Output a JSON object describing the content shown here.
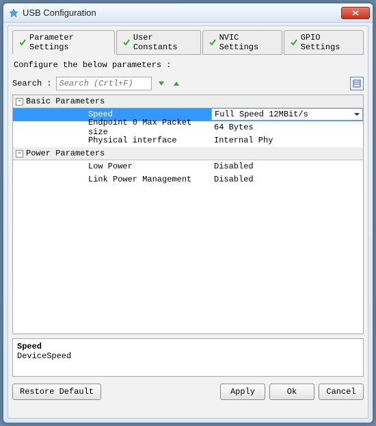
{
  "window": {
    "title": "USB Configuration"
  },
  "tabs": [
    {
      "label": "Parameter Settings"
    },
    {
      "label": "User Constants"
    },
    {
      "label": "NVIC Settings"
    },
    {
      "label": "GPIO Settings"
    }
  ],
  "instruction": "Configure the below parameters :",
  "search": {
    "label": "Search :",
    "placeholder": "Search (Crtl+F)"
  },
  "groups": [
    {
      "name": "Basic Parameters",
      "rows": [
        {
          "label": "Speed",
          "value": "Full Speed 12MBit/s",
          "selected": true,
          "dropdown": true
        },
        {
          "label": "Endpoint 0 Max Packet size",
          "value": "64 Bytes"
        },
        {
          "label": "Physical interface",
          "value": "Internal Phy"
        }
      ]
    },
    {
      "name": "Power Parameters",
      "rows": [
        {
          "label": "Low Power",
          "value": "Disabled"
        },
        {
          "label": "Link Power Management",
          "value": "Disabled"
        }
      ]
    }
  ],
  "description": {
    "title": "Speed",
    "body": "DeviceSpeed"
  },
  "buttons": {
    "restore": "Restore Default",
    "apply": "Apply",
    "ok": "Ok",
    "cancel": "Cancel"
  }
}
